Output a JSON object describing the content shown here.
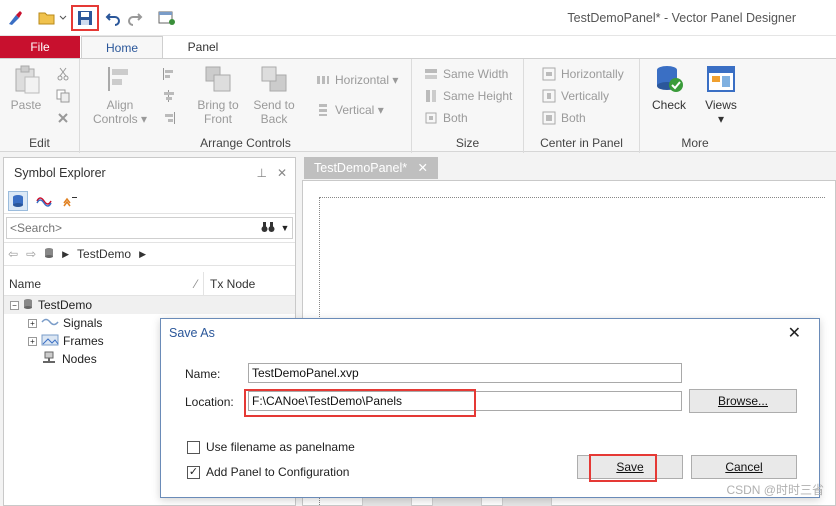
{
  "window": {
    "title": "TestDemoPanel* - Vector Panel Designer"
  },
  "ribbon_tabs": [
    {
      "label": "File"
    },
    {
      "label": "Home"
    },
    {
      "label": "Panel"
    }
  ],
  "ribbon": {
    "edit": {
      "label": "Edit",
      "paste": "Paste"
    },
    "arrange": {
      "label": "Arrange Controls",
      "align_line1": "Align",
      "align_line2": "Controls",
      "bring_line1": "Bring to",
      "bring_line2": "Front",
      "send_line1": "Send to",
      "send_line2": "Back",
      "horizontal": "Horizontal",
      "vertical": "Vertical"
    },
    "size": {
      "label": "Size",
      "same_width": "Same Width",
      "same_height": "Same Height",
      "both": "Both"
    },
    "center": {
      "label": "Center in Panel",
      "horizontally": "Horizontally",
      "vertically": "Vertically",
      "both": "Both"
    },
    "more": {
      "label": "More",
      "check": "Check",
      "views": "Views"
    }
  },
  "explorer": {
    "title": "Symbol Explorer",
    "search_placeholder": "<Search>",
    "breadcrumb": "TestDemo",
    "columns": {
      "name": "Name",
      "tx": "Tx Node"
    },
    "tree": [
      {
        "label": "TestDemo"
      },
      {
        "label": "Signals"
      },
      {
        "label": "Frames"
      },
      {
        "label": "Nodes"
      }
    ]
  },
  "document_tab": {
    "label": "TestDemoPanel*"
  },
  "dialog": {
    "title": "Save As",
    "name_label": "Name:",
    "name_value": "TestDemoPanel.xvp",
    "location_label": "Location:",
    "location_value": "F:\\CANoe\\TestDemo\\Panels",
    "browse": "Browse...",
    "check_filename": {
      "label": "Use filename as panelname",
      "checked": false
    },
    "check_config": {
      "label": "Add Panel to Configuration",
      "checked": true
    },
    "save": "Save",
    "cancel": "Cancel"
  },
  "watermark": "CSDN @时时三省",
  "colors": {
    "file_tab": "#c8102e",
    "accent": "#2b579a",
    "highlight": "#e53935"
  }
}
